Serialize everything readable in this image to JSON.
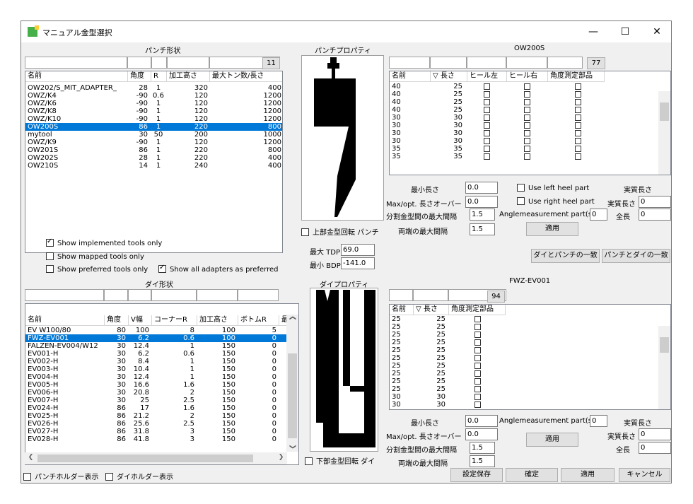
{
  "window": {
    "title": "マニュアル金型選択",
    "minimize": "—",
    "maximize": "☐",
    "close": "✕"
  },
  "punch": {
    "section_title": "パンチ形状",
    "count": "11",
    "columns": [
      "名前",
      "角度",
      "R",
      "加工高さ",
      "最大トン数/長さ"
    ],
    "rows": [
      [
        "OW202/S_MIT_ADAPTER_",
        "28",
        "1",
        "320",
        "400"
      ],
      [
        "OWZ/K4",
        "-90",
        "0.6",
        "120",
        "1200"
      ],
      [
        "OWZ/K6",
        "-90",
        "1",
        "120",
        "1200"
      ],
      [
        "OWZ/K8",
        "-90",
        "1",
        "120",
        "1200"
      ],
      [
        "OWZ/K10",
        "-90",
        "1",
        "120",
        "1200"
      ],
      [
        "OW200S",
        "86",
        "1",
        "220",
        "800"
      ],
      [
        "mytool",
        "30",
        "50",
        "200",
        "1000"
      ],
      [
        "OWZ/K9",
        "-90",
        "1",
        "120",
        "1200"
      ],
      [
        "OW201S",
        "86",
        "1",
        "220",
        "800"
      ],
      [
        "OW202S",
        "28",
        "1",
        "220",
        "400"
      ],
      [
        "OW210S",
        "14",
        "1",
        "240",
        "400"
      ]
    ],
    "selected_index": 5
  },
  "options": {
    "show_implemented": "Show implemented tools only",
    "show_mapped": "Show mapped tools only",
    "show_preferred": "Show preferred tools only",
    "show_adapters": "Show all adapters as preferred"
  },
  "punch_props": {
    "title": "パンチプロパティ",
    "rotate": "上部金型回転 パンチ",
    "max_tdp_label": "最大 TDP",
    "max_tdp": "69.0",
    "min_bdp_label": "最小 BDP",
    "min_bdp": "-141.0"
  },
  "ow200s": {
    "title": "OW200S",
    "count": "77",
    "columns": [
      "名前",
      "▽ 長さ",
      "ヒール左",
      "ヒール右",
      "角度測定部品"
    ],
    "rows": [
      [
        "40",
        "25"
      ],
      [
        "40",
        "25"
      ],
      [
        "40",
        "25"
      ],
      [
        "40",
        "25"
      ],
      [
        "30",
        "30"
      ],
      [
        "30",
        "30"
      ],
      [
        "30",
        "30"
      ],
      [
        "30",
        "30"
      ],
      [
        "35",
        "35"
      ],
      [
        "35",
        "35"
      ]
    ],
    "min_len_label": "最小長さ",
    "min_len": "0.0",
    "max_over_label": "Max/opt. 長さオーバー",
    "max_over": "0.0",
    "max_gap_label": "分割金型間の最大間隔",
    "max_gap": "1.5",
    "end_gap_label": "両端の最大間隔",
    "end_gap": "1.5",
    "use_left": "Use left heel part",
    "use_right": "Use right heel part",
    "angle_part_label": "Anglemeasurement part(s)",
    "angle_part": "0",
    "actual_len_title": "実質長さ",
    "actual_len_label": "実質長さ",
    "actual_len": "0",
    "total_len_label": "全長",
    "total_len": "0",
    "apply": "適用"
  },
  "match": {
    "die_punch": "ダイとパンチの一致",
    "punch_die": "パンチとダイの一致"
  },
  "die": {
    "section_title": "ダイ形状",
    "columns": [
      "名前",
      "角度",
      "V幅",
      "コーナーR",
      "加工高さ",
      "ボトムR",
      "最"
    ],
    "rows": [
      [
        "EV W100/80",
        "80",
        "100",
        "8",
        "100",
        "5"
      ],
      [
        "FWZ-EV001",
        "30",
        "6.2",
        "0.6",
        "100",
        "0"
      ],
      [
        "FALZEN-EV004/W12",
        "30",
        "12.4",
        "1",
        "150",
        "0"
      ],
      [
        "EV001-H",
        "30",
        "6.2",
        "0.6",
        "150",
        "0"
      ],
      [
        "EV002-H",
        "30",
        "8.4",
        "1",
        "150",
        "0"
      ],
      [
        "EV003-H",
        "30",
        "10.4",
        "1",
        "150",
        "0"
      ],
      [
        "EV004-H",
        "30",
        "12.4",
        "1",
        "150",
        "0"
      ],
      [
        "EV005-H",
        "30",
        "16.6",
        "1.6",
        "150",
        "0"
      ],
      [
        "EV006-H",
        "30",
        "20.8",
        "2",
        "150",
        "0"
      ],
      [
        "EV007-H",
        "30",
        "25",
        "2.5",
        "150",
        "0"
      ],
      [
        "EV024-H",
        "86",
        "17",
        "1.6",
        "150",
        "0"
      ],
      [
        "EV025-H",
        "86",
        "21.2",
        "2",
        "150",
        "0"
      ],
      [
        "EV026-H",
        "86",
        "25.6",
        "2.5",
        "150",
        "0"
      ],
      [
        "EV027-H",
        "86",
        "31.8",
        "3",
        "150",
        "0"
      ],
      [
        "EV028-H",
        "86",
        "41.8",
        "3",
        "150",
        "0"
      ]
    ],
    "selected_index": 1
  },
  "die_props": {
    "title": "ダイプロパティ",
    "rotate": "下部金型回転 ダイ"
  },
  "fwz": {
    "title": "FWZ-EV001",
    "count": "94",
    "columns": [
      "名前",
      "▽ 長さ",
      "角度測定部品"
    ],
    "rows": [
      [
        "25",
        "25"
      ],
      [
        "25",
        "25"
      ],
      [
        "25",
        "25"
      ],
      [
        "25",
        "25"
      ],
      [
        "25",
        "25"
      ],
      [
        "25",
        "25"
      ],
      [
        "25",
        "25"
      ],
      [
        "25",
        "25"
      ],
      [
        "25",
        "25"
      ],
      [
        "25",
        "25"
      ],
      [
        "30",
        "30"
      ],
      [
        "30",
        "30"
      ]
    ],
    "min_len_label": "最小長さ",
    "min_len": "0.0",
    "max_over_label": "Max/opt. 長さオーバー",
    "max_over": "0.0",
    "max_gap_label": "分割金型間の最大間隔",
    "max_gap": "1.5",
    "end_gap_label": "両端の最大間隔",
    "end_gap": "1.5",
    "angle_part_label": "Anglemeasurement part(s)",
    "angle_part": "0",
    "actual_len_title": "実質長さ",
    "actual_len_label": "実質長さ",
    "actual_len": "0",
    "total_len_label": "全長",
    "total_len": "0",
    "apply": "適用"
  },
  "bottom": {
    "punch_holder": "パンチホルダー表示",
    "die_holder": "ダイホルダー表示",
    "save": "設定保存",
    "ok": "確定",
    "apply": "適用",
    "cancel": "キャンセル"
  },
  "colors": {
    "selection": "#0078d7",
    "dialog_bg": "#f0f0f0"
  }
}
